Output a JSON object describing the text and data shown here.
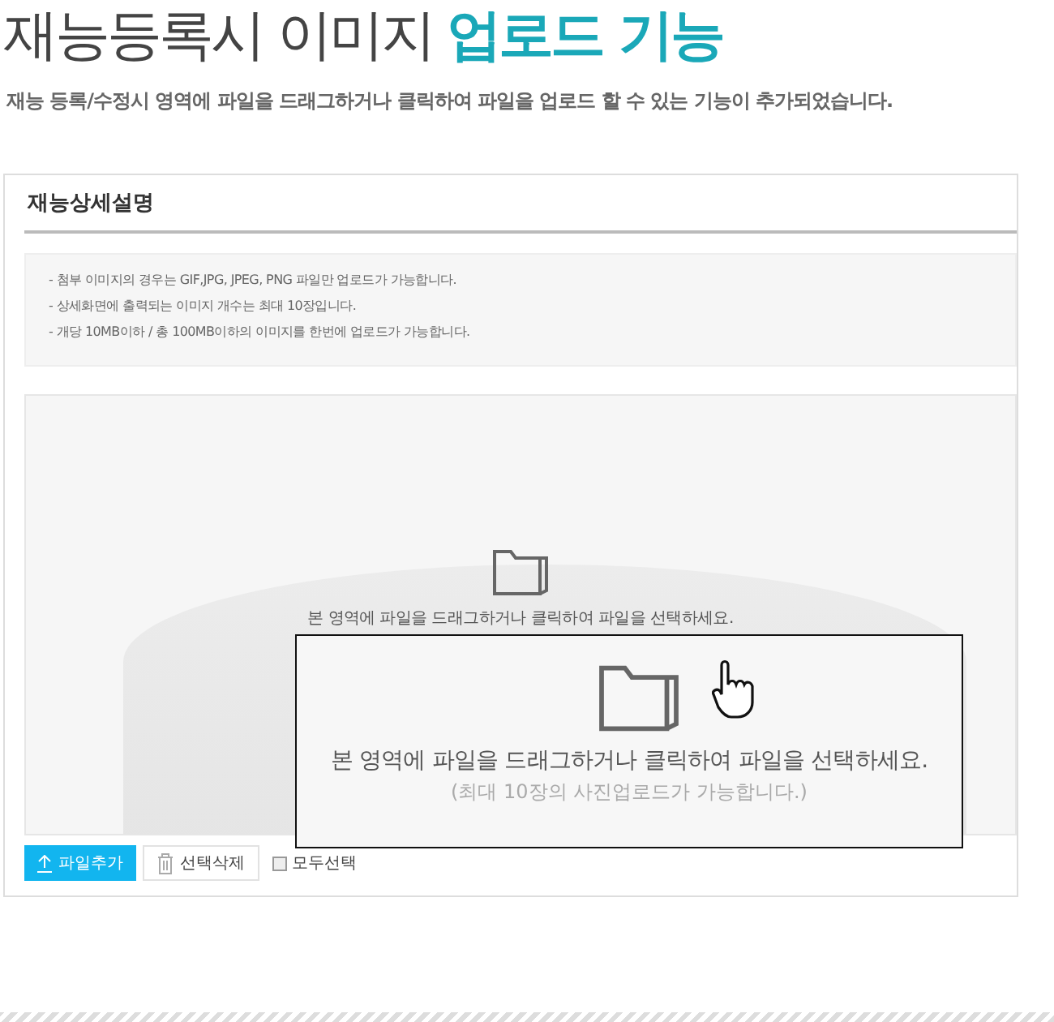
{
  "heading": {
    "title": "재능등록시 이미지",
    "highlight": "업로드 기능"
  },
  "subtitle": "재능 등록/수정시 영역에 파일을 드래그하거나 클릭하여 파일을 업로드 할 수 있는 기능이 추가되었습니다.",
  "panel": {
    "title": "재능상세설명",
    "notes": [
      "- 첨부 이미지의 경우는 GIF,JPG, JPEG, PNG 파일만 업로드가 가능합니다.",
      "- 상세화면에 출력되는 이미지 개수는 최대 10장입니다.",
      "- 개당 10MB이하 / 총 100MB이하의 이미지를 한번에 업로드가 가능합니다."
    ],
    "dropzone": {
      "text": "본 영역에 파일을 드래그하거나 클릭하여 파일을 선택하세요."
    },
    "magnified": {
      "text": "본 영역에 파일을 드래그하거나 클릭하여 파일을 선택하세요.",
      "subtext": "(최대 10장의 사진업로드가 가능합니다.)"
    },
    "toolbar": {
      "add_button": "파일추가",
      "delete_button": "선택삭제",
      "select_all": {
        "label": "모두선택",
        "checked": false
      }
    }
  }
}
